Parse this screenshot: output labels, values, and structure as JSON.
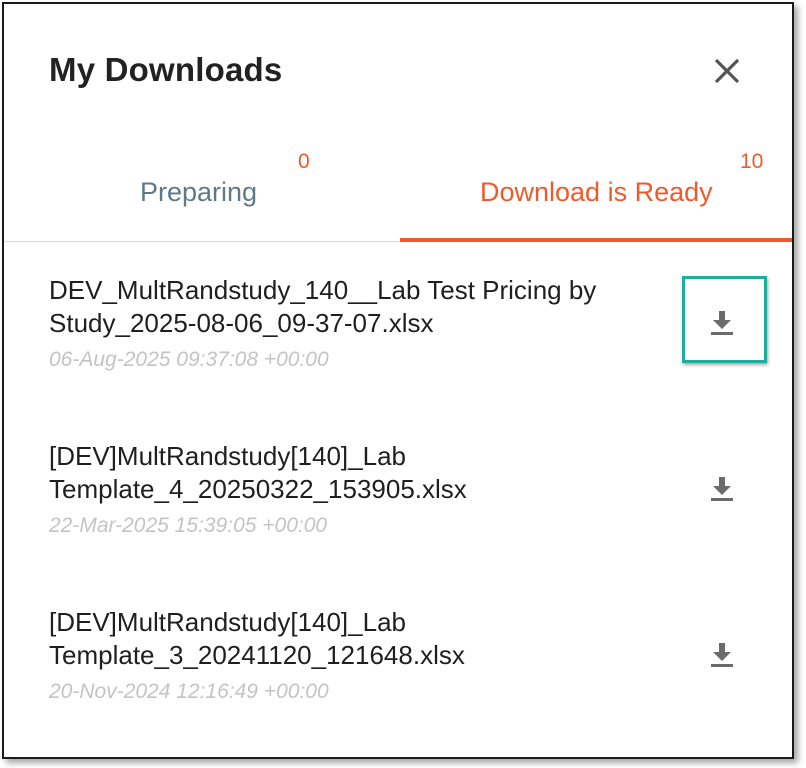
{
  "dialog": {
    "title": "My Downloads",
    "close_icon": "close-icon"
  },
  "tabs": [
    {
      "label": "Preparing",
      "count": "0",
      "active": false
    },
    {
      "label": "Download is Ready",
      "count": "10",
      "active": true
    }
  ],
  "downloads": [
    {
      "filename": "DEV_MultRandstudy_140__Lab Test Pricing by Study_2025-08-06_09-37-07.xlsx",
      "timestamp": "06-Aug-2025 09:37:08 +00:00",
      "icon": "download-icon",
      "highlighted": true
    },
    {
      "filename": "[DEV]MultRandstudy[140]_Lab Template_4_20250322_153905.xlsx",
      "timestamp": "22-Mar-2025 15:39:05 +00:00",
      "icon": "download-icon",
      "highlighted": false
    },
    {
      "filename": "[DEV]MultRandstudy[140]_Lab Template_3_20241120_121648.xlsx",
      "timestamp": "20-Nov-2024 12:16:49 +00:00",
      "icon": "download-icon",
      "highlighted": false
    }
  ],
  "colors": {
    "accent": "#ee5a2c",
    "inactive_tab": "#5f7a86",
    "timestamp": "#c4c4c4",
    "highlight": "#1fae9e"
  }
}
